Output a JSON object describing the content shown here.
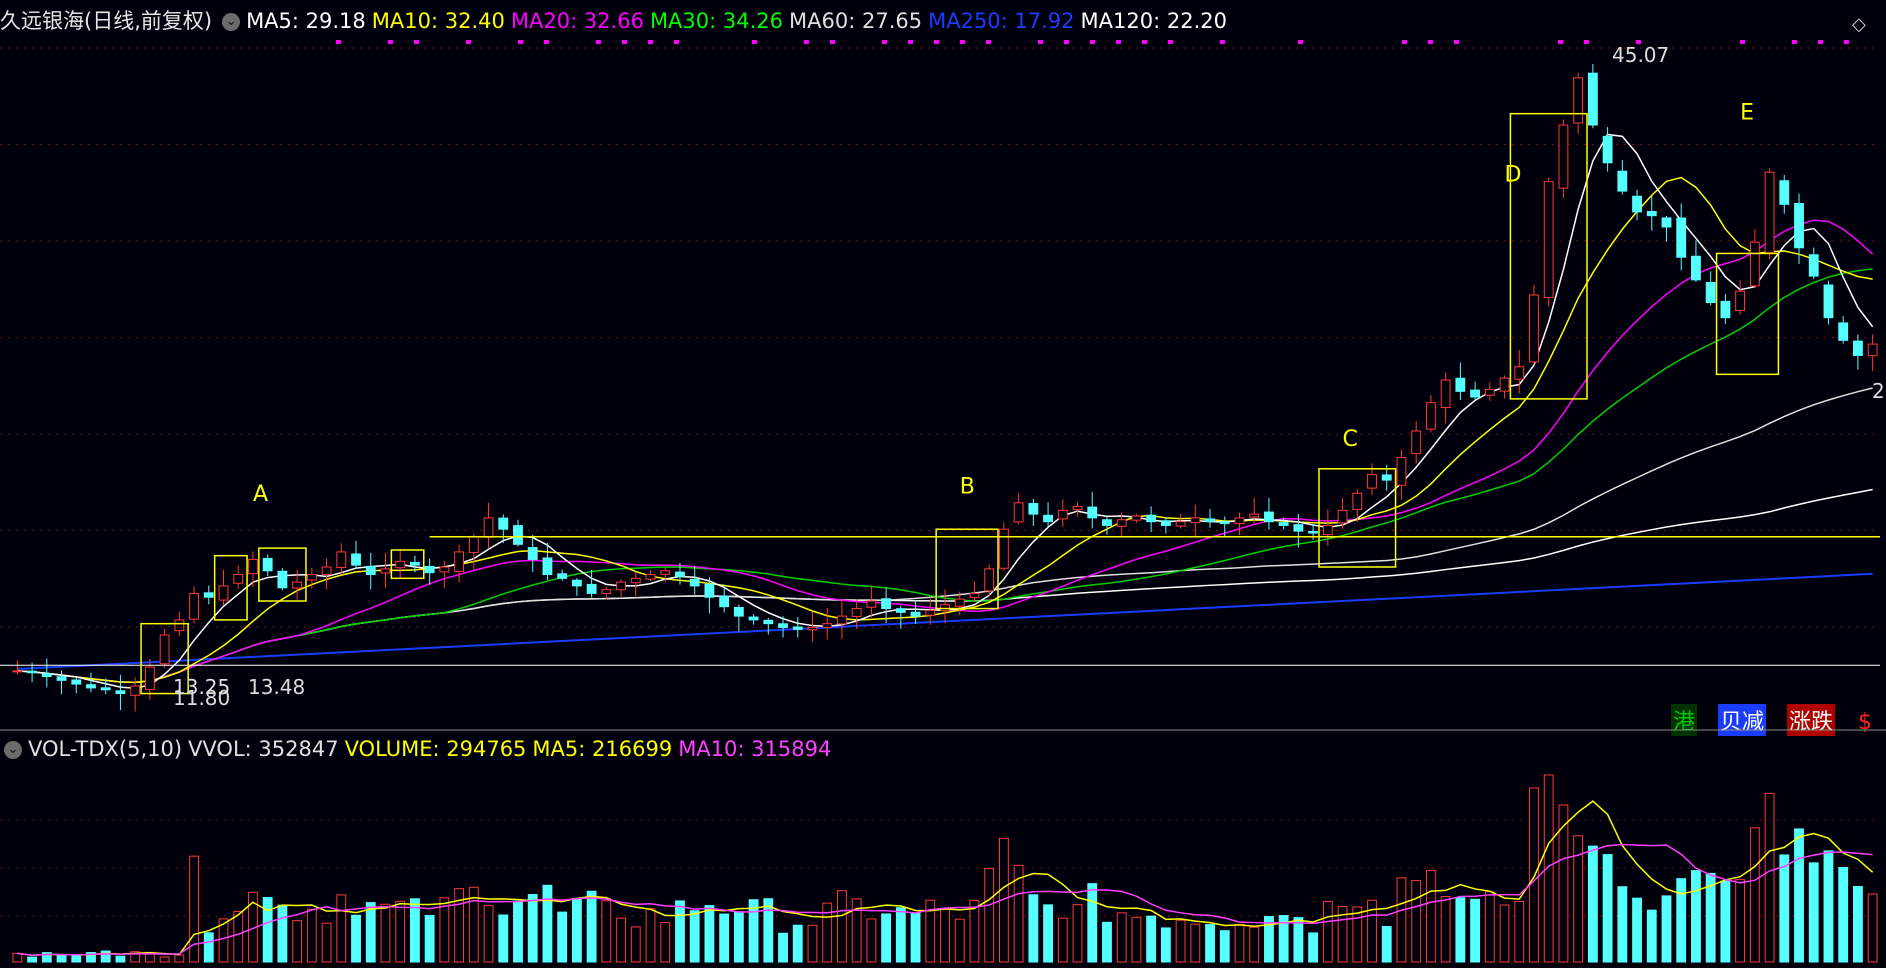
{
  "header": {
    "title": "久远银海(日线,前复权)",
    "mas": [
      {
        "label": "MA5: 29.18",
        "color": "#ffffff"
      },
      {
        "label": "MA10: 32.40",
        "color": "#ffff00"
      },
      {
        "label": "MA20: 32.66",
        "color": "#ff00ff"
      },
      {
        "label": "MA30: 34.26",
        "color": "#00ff00"
      },
      {
        "label": "MA60: 27.65",
        "color": "#e0e0e0"
      },
      {
        "label": "MA250: 17.92",
        "color": "#1a3cff"
      },
      {
        "label": "MA120: 22.20",
        "color": "#ffffff"
      }
    ]
  },
  "volume_header": {
    "label": "VOL-TDX(5,10)",
    "items": [
      {
        "label": "VVOL: 352847",
        "color": "#e0e0e0"
      },
      {
        "label": "VOLUME: 294765",
        "color": "#ffff00"
      },
      {
        "label": "MA5: 216699",
        "color": "#ffff00"
      },
      {
        "label": "MA10: 315894",
        "color": "#ff40ff"
      }
    ]
  },
  "badges": [
    {
      "text": "港",
      "color": "#00c800",
      "bg": "#003300"
    },
    {
      "text": "贝减",
      "color": "#ffffff",
      "bg": "#1a3cff"
    },
    {
      "text": "涨跌",
      "color": "#ffffff",
      "bg": "#b00000"
    },
    {
      "text": "$",
      "color": "#ff2020",
      "bg": "transparent"
    }
  ],
  "chart_data": {
    "type": "candlestick",
    "price_range": [
      10.5,
      46.5
    ],
    "annotations": {
      "high_label": "45.07",
      "low_label": "11.80",
      "mid_label": "13.25",
      "mid_label2": "13.48",
      "last_label": "2"
    },
    "box_labels": [
      "A",
      "B",
      "C",
      "D",
      "E"
    ],
    "ohlc_anchor_closes": [
      13.1,
      13.0,
      12.8,
      12.6,
      12.4,
      12.2,
      12.1,
      11.9,
      12.3,
      13.3,
      15.0,
      15.8,
      17.2,
      17.0,
      17.6,
      18.2,
      19.0,
      18.4,
      17.5,
      17.8,
      18.2,
      18.6,
      19.4,
      18.7,
      18.2,
      18.5,
      18.9,
      18.7,
      18.3,
      18.6,
      19.4,
      20.2,
      21.2,
      20.6,
      19.8,
      19.0,
      18.2,
      18.0,
      17.6,
      17.2,
      17.4,
      17.8,
      18.0,
      18.2,
      18.4,
      18.1,
      17.6,
      17.0,
      16.5,
      16.0,
      15.8,
      15.6,
      15.4,
      15.3,
      15.4,
      15.6,
      16.0,
      16.4,
      16.8,
      16.4,
      16.2,
      16.0,
      16.3,
      16.6,
      16.9,
      17.2,
      18.5,
      20.6,
      22.0,
      21.4,
      21.0,
      21.6,
      21.8,
      21.2,
      20.8,
      21.1,
      21.3,
      21.0,
      20.8,
      21.0,
      21.2,
      21.0,
      20.9,
      21.2,
      21.4,
      21.0,
      20.8,
      20.5,
      20.4,
      20.8,
      21.6,
      22.5,
      23.5,
      23.2,
      24.4,
      25.8,
      27.3,
      28.5,
      27.9,
      27.6,
      28.0,
      28.6,
      29.2,
      33.0,
      39.0,
      42.0,
      44.5,
      42.0,
      40.0,
      38.5,
      37.4,
      37.2,
      36.6,
      35.0,
      33.8,
      32.6,
      31.8,
      33.2,
      35.8,
      39.5,
      37.8,
      35.5,
      34.0,
      31.8,
      30.6,
      29.8,
      30.4
    ],
    "volume_range": [
      0,
      7700
    ]
  }
}
